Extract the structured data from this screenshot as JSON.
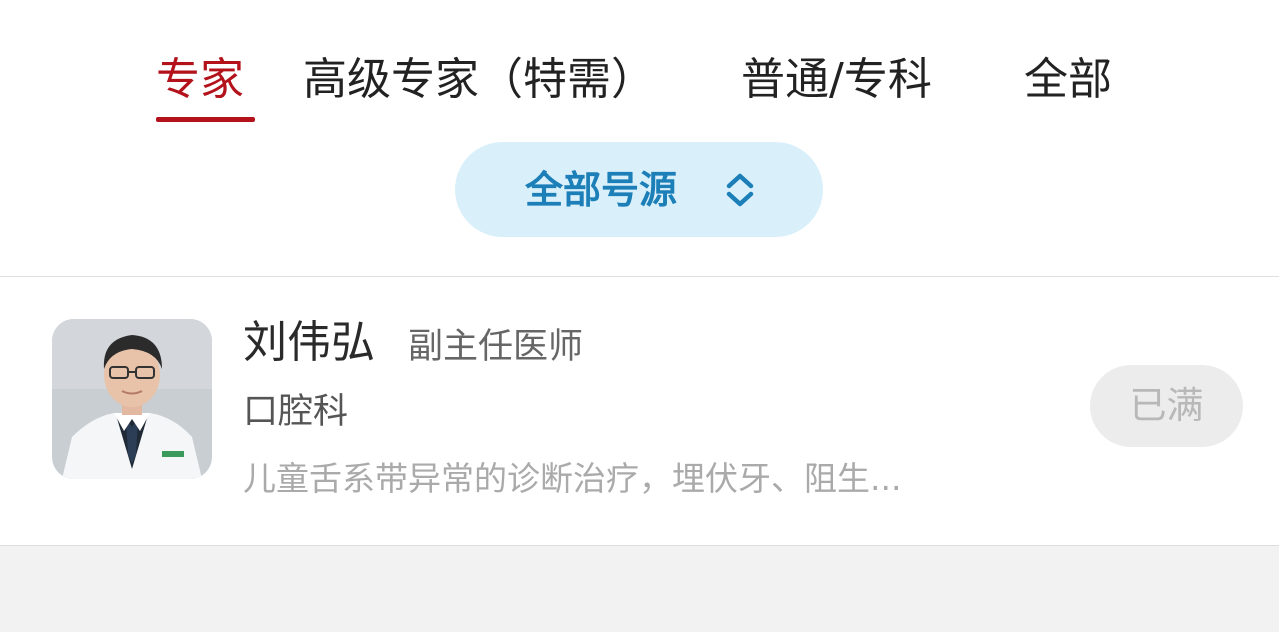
{
  "tabs": [
    {
      "label": "专家",
      "active": true
    },
    {
      "label": "高级专家（特需）",
      "active": false
    },
    {
      "label": "普通/专科",
      "active": false
    },
    {
      "label": "全部",
      "active": false
    }
  ],
  "filter": {
    "label": "全部号源",
    "icon": "chevron-up-down-icon"
  },
  "doctor": {
    "name": "刘伟弘",
    "title": "副主任医师",
    "department": "口腔科",
    "specialty": "儿童舌系带异常的诊断治疗，埋伏牙、阻生...",
    "status": "已满"
  },
  "colors": {
    "accent": "#b3121b",
    "filter_bg": "#d9f0fb",
    "filter_text": "#1d7fb8",
    "page_bg": "#f2f2f2"
  }
}
